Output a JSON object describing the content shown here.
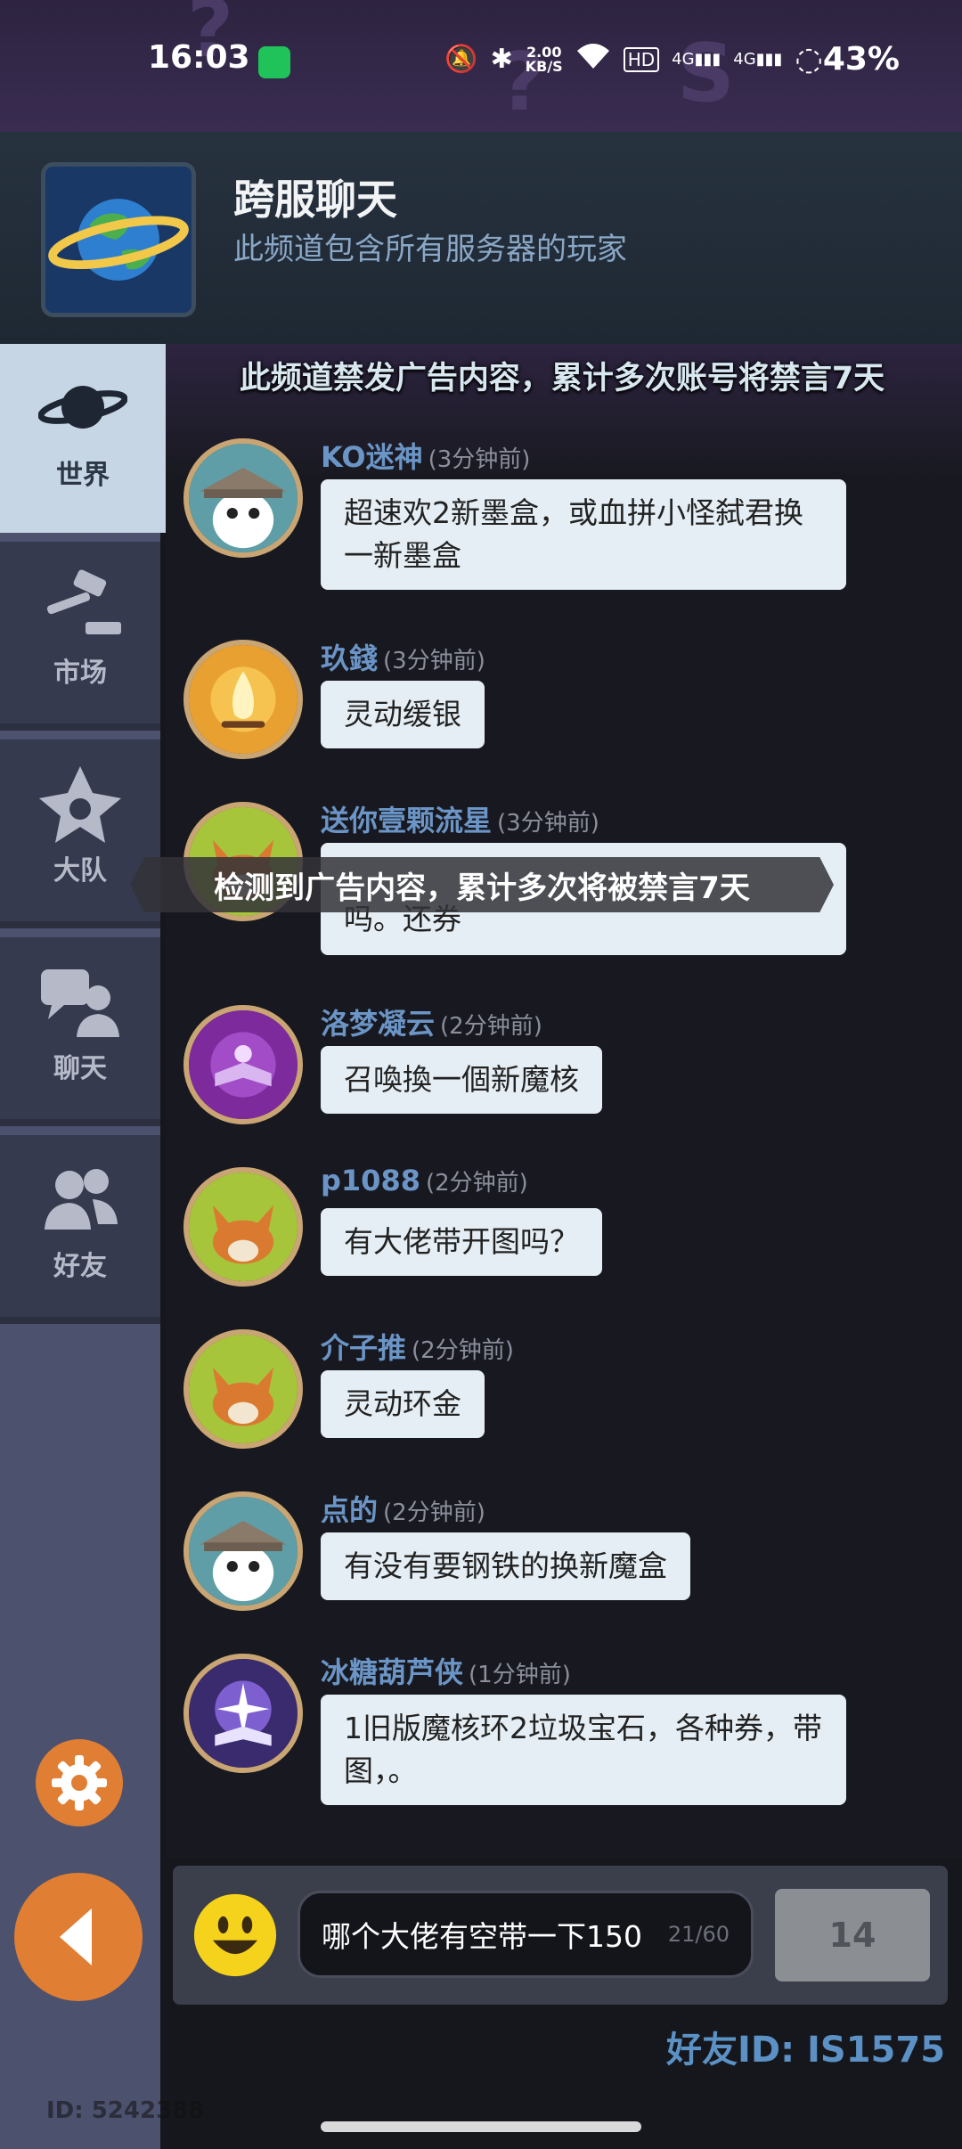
{
  "status_bar": {
    "time": "16:03",
    "speed": "2.00",
    "speed_unit": "KB/S",
    "hd": "HD",
    "net1": "4G",
    "net2": "4G",
    "battery": "43%"
  },
  "header": {
    "title": "跨服聊天",
    "subtitle": "此频道包含所有服务器的玩家"
  },
  "banner": "此频道禁发广告内容，累计多次账号将禁言7天",
  "sidebar": {
    "tabs": [
      {
        "label": "世界",
        "icon": "planet-icon",
        "active": true
      },
      {
        "label": "市场",
        "icon": "gavel-icon",
        "active": false
      },
      {
        "label": "大队",
        "icon": "guild-icon",
        "active": false
      },
      {
        "label": "聊天",
        "icon": "chat-icon",
        "active": false
      },
      {
        "label": "好友",
        "icon": "friends-icon",
        "active": false
      }
    ],
    "device_id": "ID: 5242388"
  },
  "messages": [
    {
      "name": "KO迷神",
      "time": "(3分钟前)",
      "text": "超速欢2新墨盒，或血拼小怪弑君换一新墨盒",
      "avatar": "hat-cat-avatar"
    },
    {
      "name": "玖錢",
      "time": "(3分钟前)",
      "text": "灵动缓银",
      "avatar": "campfire-avatar"
    },
    {
      "name": "送你壹颗流星",
      "time": "(3分钟前)",
      "text": "吗。还券",
      "avatar": "fox-avatar"
    },
    {
      "name": "洛梦凝云",
      "time": "(2分钟前)",
      "text": "召喚換一個新魔核",
      "avatar": "magic-book-avatar"
    },
    {
      "name": "p1088",
      "time": "(2分钟前)",
      "text": "有大佬带开图吗？",
      "avatar": "fox-avatar"
    },
    {
      "name": "介子推",
      "time": "(2分钟前)",
      "text": "灵动环金",
      "avatar": "fox-avatar"
    },
    {
      "name": "点的",
      "time": "(2分钟前)",
      "text": "有没有要钢铁的换新魔盒",
      "avatar": "hat-cat-avatar"
    },
    {
      "name": "冰糖葫芦侠",
      "time": "(1分钟前)",
      "text": "1旧版魔核环2垃圾宝石，各种券，带图，。",
      "avatar": "star-book-avatar"
    }
  ],
  "toast": "检测到广告内容，累计多次将被禁言7天",
  "input": {
    "value": "哪个大佬有空带一下150",
    "count": "21/60",
    "send_label": "14"
  },
  "friend_id": "好友ID: IS1575"
}
